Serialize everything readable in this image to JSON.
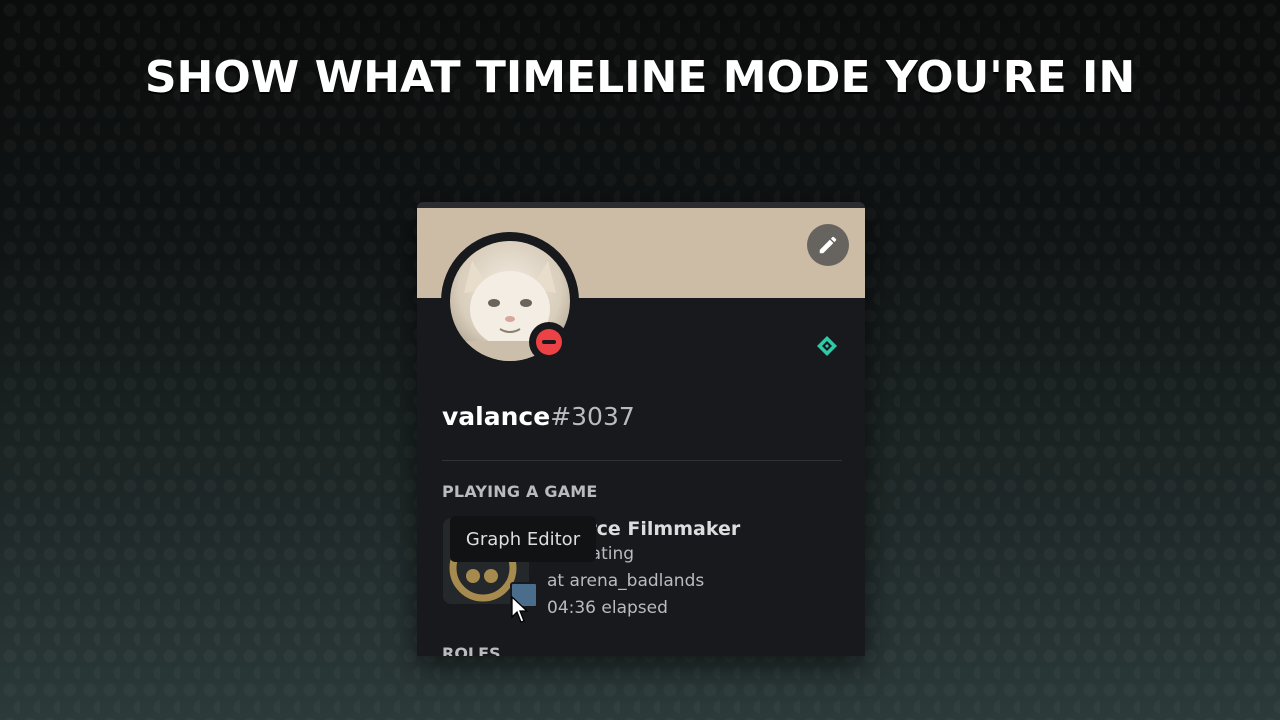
{
  "headline": "SHOW WHAT TIMELINE MODE YOU'RE IN",
  "profile": {
    "banner_color": "#ccbca6",
    "username": "valance",
    "discriminator": "#3037",
    "status": "do-not-disturb",
    "status_color": "#ed4245"
  },
  "activity": {
    "section_title": "PLAYING A GAME",
    "game_name": "Source Filmmaker",
    "details": "Animating",
    "state": "at arena_badlands",
    "elapsed": "04:36 elapsed"
  },
  "next_section": "ROLES",
  "tooltip": "Graph Editor",
  "icons": [
    "pencil-icon",
    "dnd-status-icon",
    "nitro-badge-icon",
    "sfm-game-icon",
    "timeline-mode-icon",
    "mouse-cursor-icon"
  ]
}
